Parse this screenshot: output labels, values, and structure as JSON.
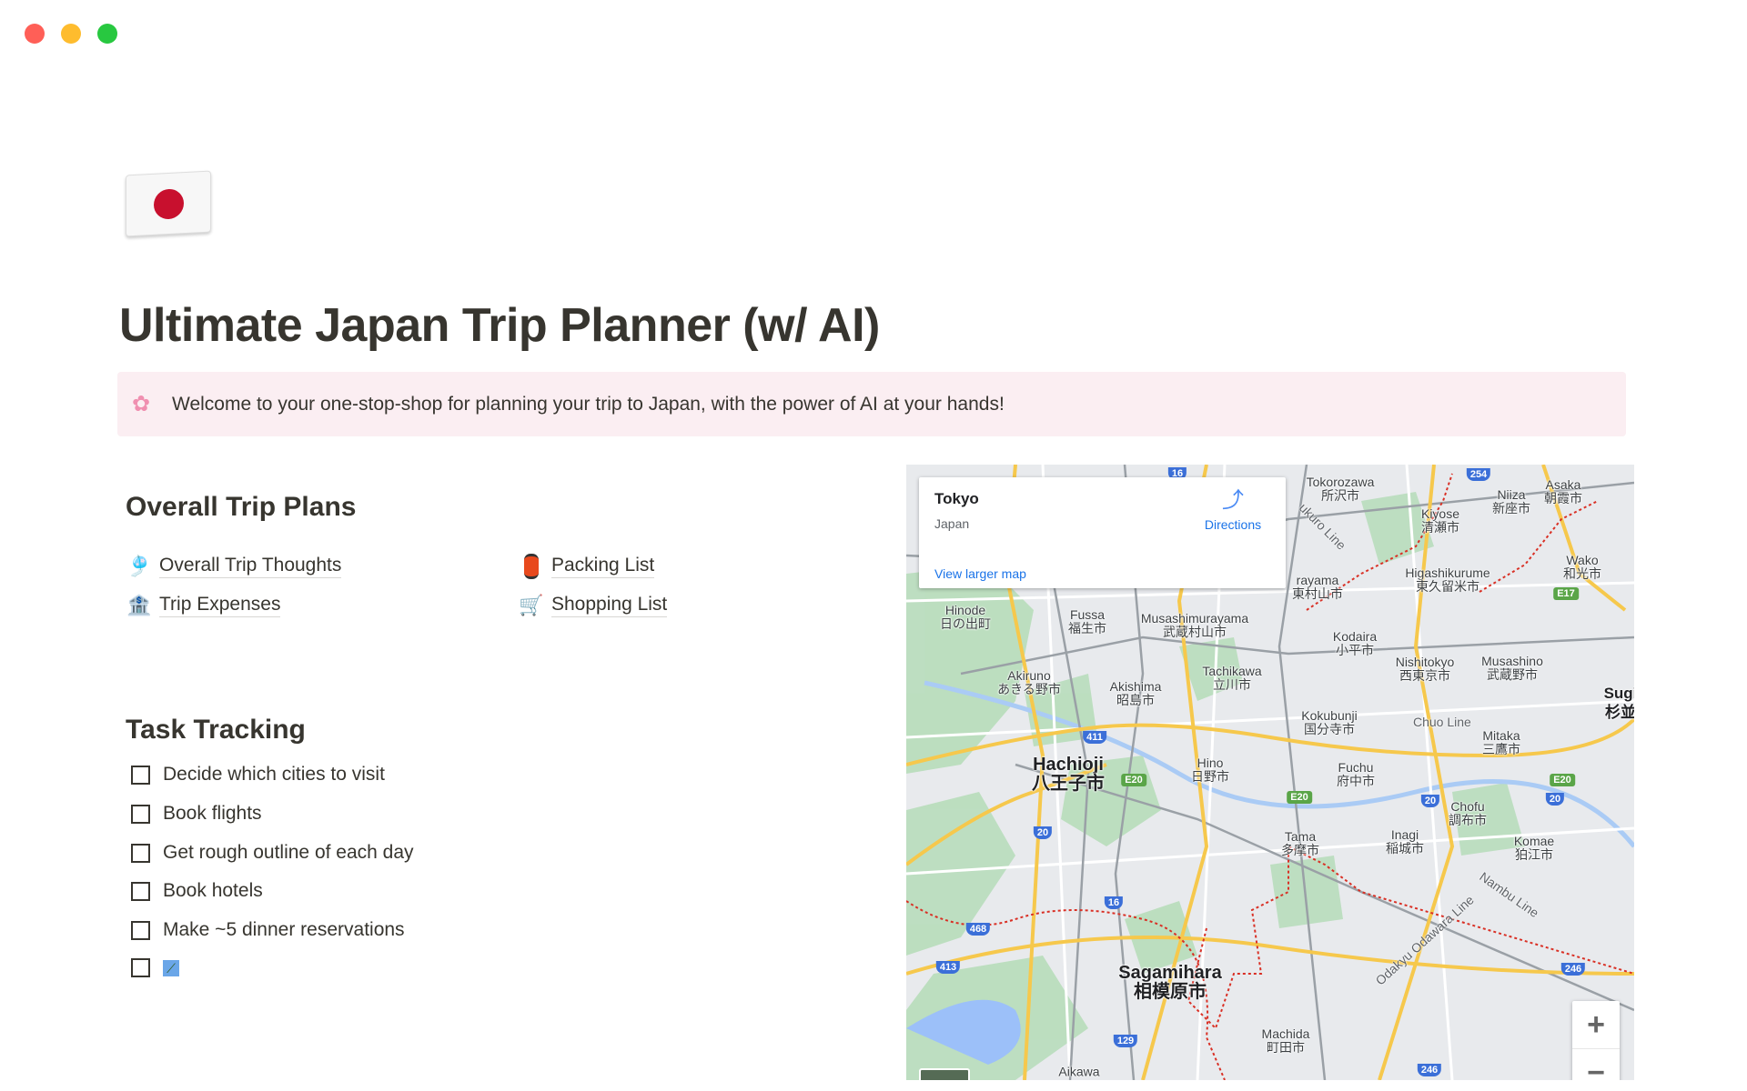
{
  "window": {
    "controls": {
      "close_color": "#ff5f57",
      "minimize_color": "#febc2e",
      "maximize_color": "#28c840"
    }
  },
  "page": {
    "icon": "japan-flag",
    "title": "Ultimate Japan Trip Planner (w/ AI)",
    "callout": {
      "icon": "cherry-blossom",
      "text": "Welcome to your one-stop-shop for planning your trip to Japan, with the power of AI at your hands!",
      "background": "#fbeef2"
    }
  },
  "trip_plans": {
    "heading": "Overall Trip Plans",
    "links": [
      {
        "icon": "wind-chime",
        "label": "Overall Trip Thoughts"
      },
      {
        "icon": "bank",
        "label": "Trip Expenses"
      },
      {
        "icon": "red-lantern",
        "label": "Packing List"
      },
      {
        "icon": "shopping-cart",
        "label": "Shopping List"
      }
    ]
  },
  "tasks": {
    "heading": "Task Tracking",
    "items": [
      {
        "label": "Decide which cities to visit",
        "checked": false
      },
      {
        "label": "Book flights",
        "checked": false
      },
      {
        "label": "Get rough outline of each day",
        "checked": false
      },
      {
        "label": "Book hotels",
        "checked": false
      },
      {
        "label": "Make ~5 dinner reservations",
        "checked": false
      },
      {
        "label": "",
        "icon": "japan-map",
        "checked": false
      }
    ]
  },
  "map": {
    "card": {
      "place": "Tokyo",
      "subtitle": "Japan",
      "directions": "Directions",
      "view_larger": "View larger map"
    },
    "zoom_in": "+",
    "zoom_out": "−",
    "places": [
      "Tokorozawa\n所沢市",
      "Niiza\n新座市",
      "Asaka\n朝霞市",
      "Kiyose\n清瀬市",
      "Wako\n和光市",
      "Higashikurume\n東久留米市",
      "rayama\n東村山市",
      "Hinode\n日の出町",
      "Fussa\n福生市",
      "Musashimurayama\n武蔵村山市",
      "Kodaira\n小平市",
      "Nishitokyo\n西東京市",
      "Musashino\n武蔵野市",
      "Akiruno\nあきる野市",
      "Akishima\n昭島市",
      "Tachikawa\n立川市",
      "Kokubunji\n国分寺市",
      "Mitaka\n三鷹市",
      "Hino\n日野市",
      "Fuchu\n府中市",
      "Chofu\n調布市",
      "Tama\n多摩市",
      "Inagi\n稲城市",
      "Komae\n狛江市",
      "Machida\n町田市",
      "Aikawa",
      "Sugi\n杉並"
    ],
    "major_places": [
      "Hachioji\n八王子市",
      "Sagamihara\n相模原市"
    ],
    "lines": [
      "Chuo Line",
      "Nambu Line",
      "Odakyu Odawara Line",
      "ukuro Line"
    ],
    "shields": [
      "16",
      "254",
      "E17",
      "411",
      "E20",
      "E20",
      "E20",
      "20",
      "20",
      "20",
      "16",
      "468",
      "413",
      "129",
      "246",
      "246"
    ]
  }
}
